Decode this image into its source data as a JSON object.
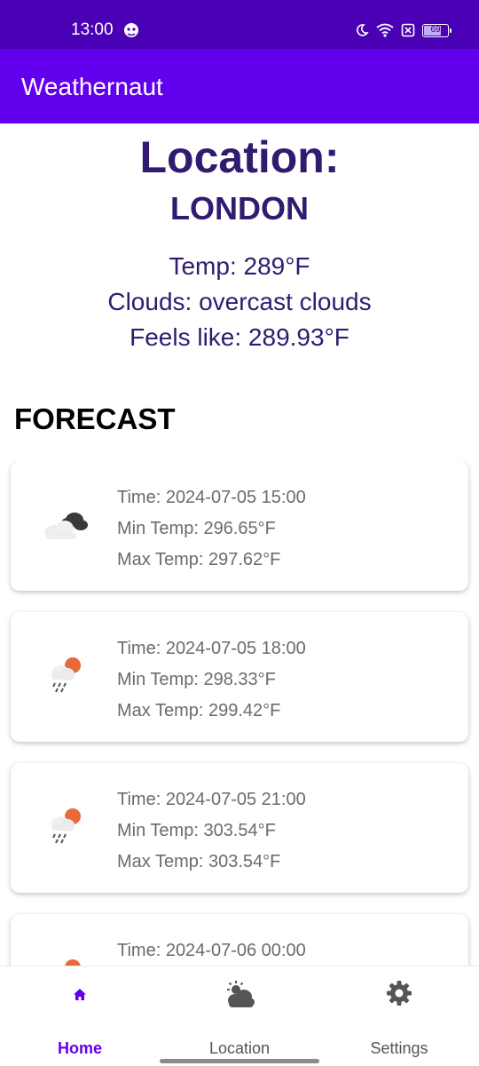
{
  "status_bar": {
    "time": "13:00",
    "battery": "69"
  },
  "app_bar": {
    "title": "Weathernaut"
  },
  "current": {
    "heading": "Location:",
    "city": "LONDON",
    "temp": "Temp: 289°F",
    "clouds": "Clouds: overcast clouds",
    "feels_like": "Feels like: 289.93°F"
  },
  "forecast": {
    "title": "FORECAST",
    "items": [
      {
        "time": "Time: 2024-07-05 15:00",
        "min": "Min Temp: 296.65°F",
        "max": "Max Temp: 297.62°F",
        "icon": "broken-clouds-icon"
      },
      {
        "time": "Time: 2024-07-05 18:00",
        "min": "Min Temp: 298.33°F",
        "max": "Max Temp: 299.42°F",
        "icon": "rain-sun-icon"
      },
      {
        "time": "Time: 2024-07-05 21:00",
        "min": "Min Temp: 303.54°F",
        "max": "Max Temp: 303.54°F",
        "icon": "rain-sun-icon"
      },
      {
        "time": "Time: 2024-07-06 00:00",
        "min": "",
        "max": "",
        "icon": "rain-sun-icon"
      }
    ]
  },
  "nav": {
    "items": [
      {
        "label": "Home",
        "icon": "home-icon",
        "active": true
      },
      {
        "label": "Location",
        "icon": "partly-cloudy-icon",
        "active": false
      },
      {
        "label": "Settings",
        "icon": "gear-icon",
        "active": false
      }
    ]
  },
  "colors": {
    "status_bar": "#4a00b4",
    "app_bar": "#6200ee",
    "heading_text": "#301b70",
    "accent": "#6200ee"
  }
}
